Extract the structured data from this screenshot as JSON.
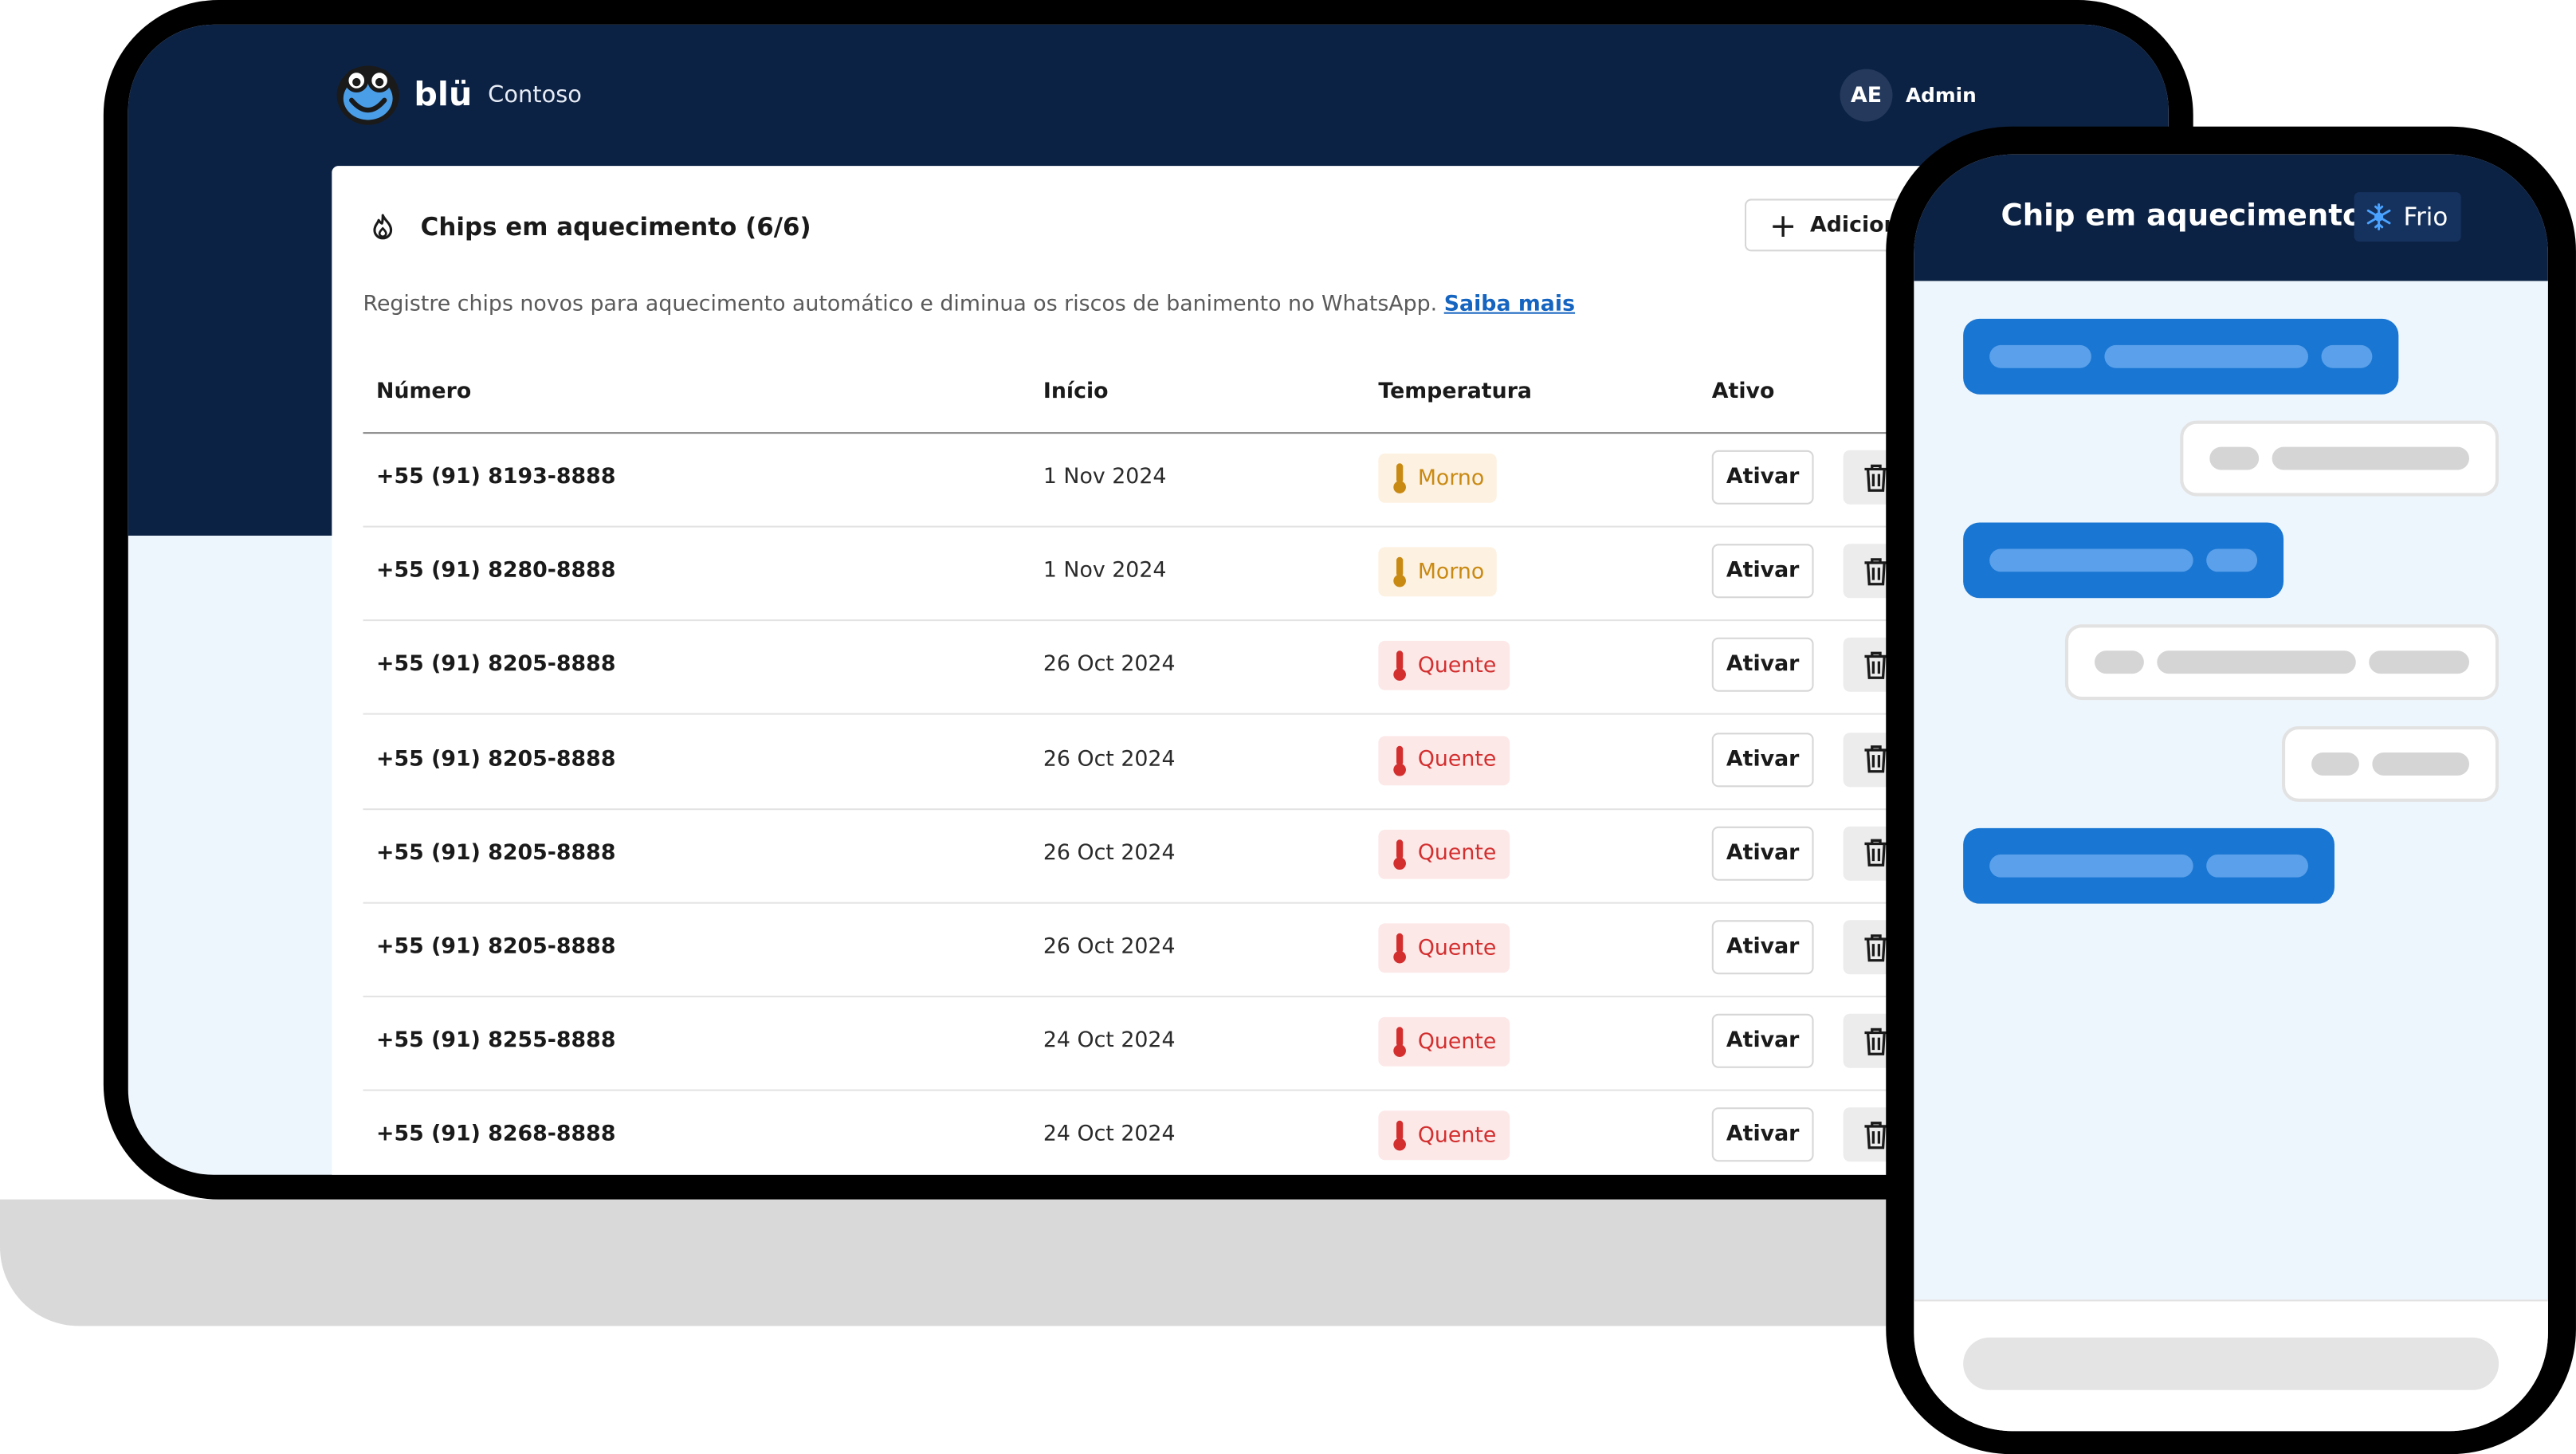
{
  "app": {
    "brand": "blü",
    "org": "Contoso",
    "user_initials": "AE",
    "user_name": "Admin"
  },
  "card": {
    "title": "Chips em aquecimento (6/6)",
    "add_label": "Adicionar",
    "description": "Registre chips novos para aquecimento automático e diminua os riscos de banimento no WhatsApp.",
    "learn_more": "Saiba mais"
  },
  "table": {
    "headers": {
      "numero": "Número",
      "inicio": "Início",
      "temperatura": "Temperatura",
      "ativo": "Ativo"
    },
    "rows": [
      {
        "numero": "+55 (91) 8193-8888",
        "inicio": "1 Nov 2024",
        "temperatura": "Morno",
        "acao": "Ativar"
      },
      {
        "numero": "+55 (91) 8280-8888",
        "inicio": "1 Nov 2024",
        "temperatura": "Morno",
        "acao": "Ativar"
      },
      {
        "numero": "+55 (91) 8205-8888",
        "inicio": "26 Oct 2024",
        "temperatura": "Quente",
        "acao": "Ativar"
      },
      {
        "numero": "+55 (91) 8205-8888",
        "inicio": "26 Oct 2024",
        "temperatura": "Quente",
        "acao": "Ativar"
      },
      {
        "numero": "+55 (91) 8205-8888",
        "inicio": "26 Oct 2024",
        "temperatura": "Quente",
        "acao": "Ativar"
      },
      {
        "numero": "+55 (91) 8205-8888",
        "inicio": "26 Oct 2024",
        "temperatura": "Quente",
        "acao": "Ativar"
      },
      {
        "numero": "+55 (91) 8255-8888",
        "inicio": "24 Oct 2024",
        "temperatura": "Quente",
        "acao": "Ativar"
      },
      {
        "numero": "+55 (91) 8268-8888",
        "inicio": "24 Oct 2024",
        "temperatura": "Quente",
        "acao": "Ativar"
      }
    ]
  },
  "phone": {
    "title": "Chip em aquecimento",
    "status": "Frio"
  },
  "colors": {
    "navy": "#0c2244",
    "accent_blue": "#1976d2",
    "morno": "#c98a14",
    "quente": "#d32f2f",
    "frio_icon": "#4aa3ff"
  },
  "icons": {
    "header": "flame-icon",
    "add": "plus-icon",
    "temperature": "thermometer-icon",
    "delete": "trash-icon",
    "frio": "snowflake-icon"
  }
}
